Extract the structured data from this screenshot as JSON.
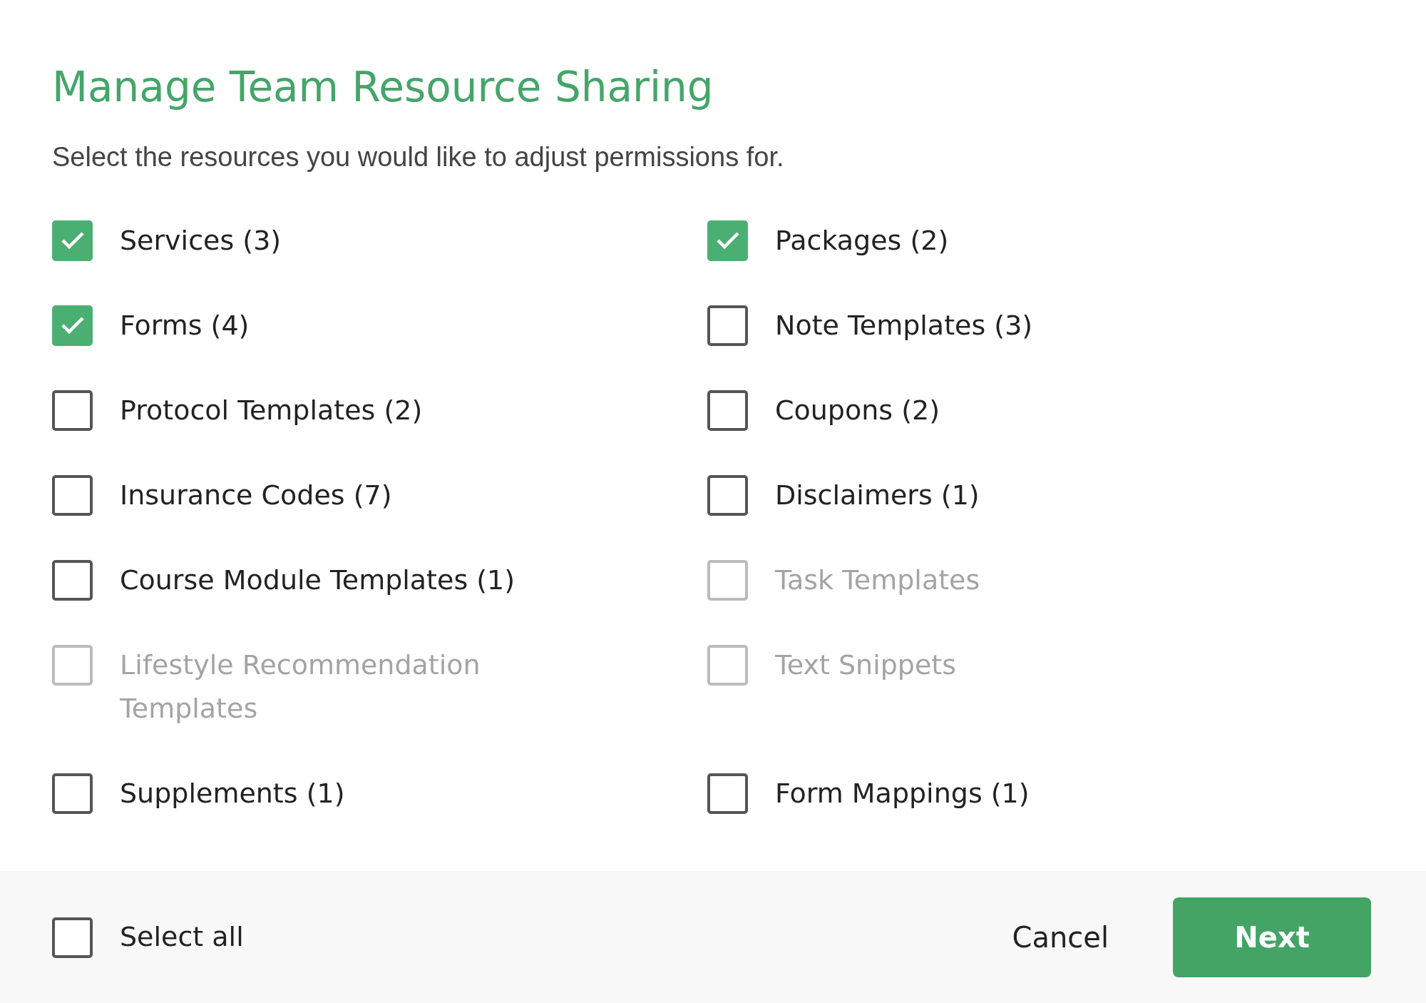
{
  "dialog": {
    "title": "Manage Team Resource Sharing",
    "subtitle": "Select the resources you would like to adjust permissions for."
  },
  "resources": [
    {
      "label": "Services (3)",
      "checked": true,
      "disabled": false
    },
    {
      "label": "Packages (2)",
      "checked": true,
      "disabled": false
    },
    {
      "label": "Forms (4)",
      "checked": true,
      "disabled": false
    },
    {
      "label": "Note Templates (3)",
      "checked": false,
      "disabled": false
    },
    {
      "label": "Protocol Templates (2)",
      "checked": false,
      "disabled": false
    },
    {
      "label": "Coupons (2)",
      "checked": false,
      "disabled": false
    },
    {
      "label": "Insurance Codes (7)",
      "checked": false,
      "disabled": false
    },
    {
      "label": "Disclaimers (1)",
      "checked": false,
      "disabled": false
    },
    {
      "label": "Course Module Templates (1)",
      "checked": false,
      "disabled": false
    },
    {
      "label": "Task Templates",
      "checked": false,
      "disabled": true
    },
    {
      "label": "Lifestyle Recommendation Templates",
      "checked": false,
      "disabled": true
    },
    {
      "label": "Text Snippets",
      "checked": false,
      "disabled": true
    },
    {
      "label": "Supplements (1)",
      "checked": false,
      "disabled": false
    },
    {
      "label": "Form Mappings (1)",
      "checked": false,
      "disabled": false
    }
  ],
  "footer": {
    "select_all": {
      "label": "Select all",
      "checked": false
    },
    "buttons": [
      {
        "label": "Cancel",
        "kind": "secondary"
      },
      {
        "label": "Next",
        "kind": "primary"
      }
    ]
  }
}
